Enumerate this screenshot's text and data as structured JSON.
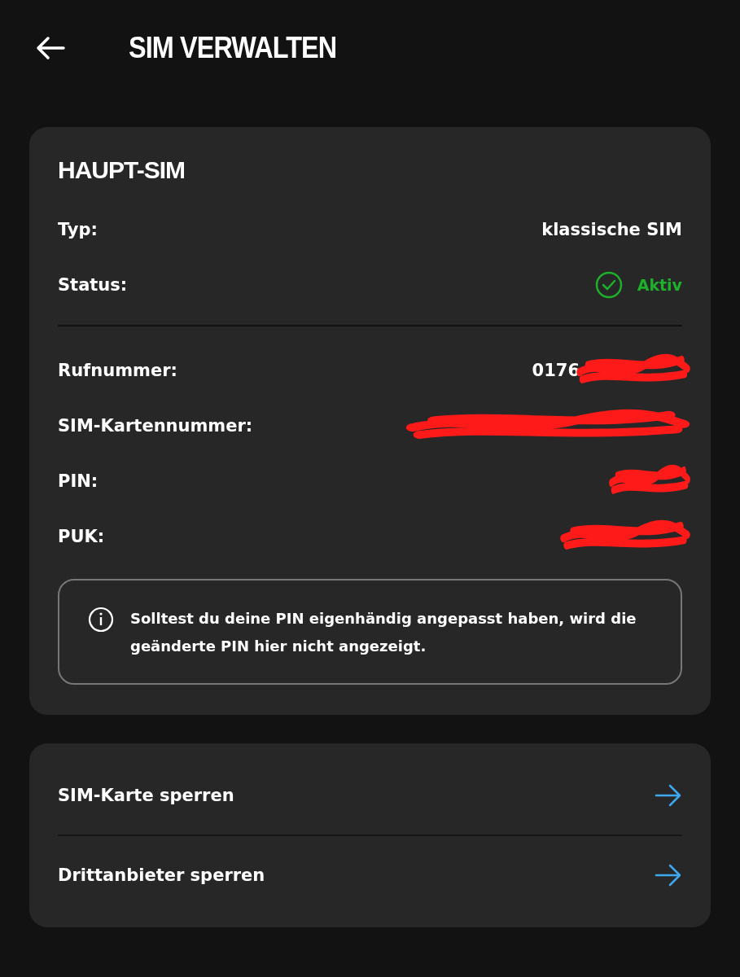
{
  "header": {
    "title": "SIM VERWALTEN"
  },
  "sim_card": {
    "title": "HAUPT-SIM",
    "details": [
      {
        "label": "Typ:",
        "value": "klassische SIM",
        "kind": "text"
      },
      {
        "label": "Status:",
        "value": "Aktiv",
        "kind": "status",
        "active": true
      }
    ],
    "numbers": [
      {
        "label": "Rufnummer:",
        "value": "0176",
        "redacted": true
      },
      {
        "label": "SIM-Kartennummer:",
        "redacted": true
      },
      {
        "label": "PIN:",
        "redacted": true
      },
      {
        "label": "PUK:",
        "redacted": true
      }
    ],
    "info": "Solltest du deine PIN eigenhändig angepasst haben, wird die geänderte PIN hier nicht angezeigt."
  },
  "actions": [
    {
      "label": "SIM-Karte sperren"
    },
    {
      "label": "Drittanbieter sperren"
    }
  ]
}
